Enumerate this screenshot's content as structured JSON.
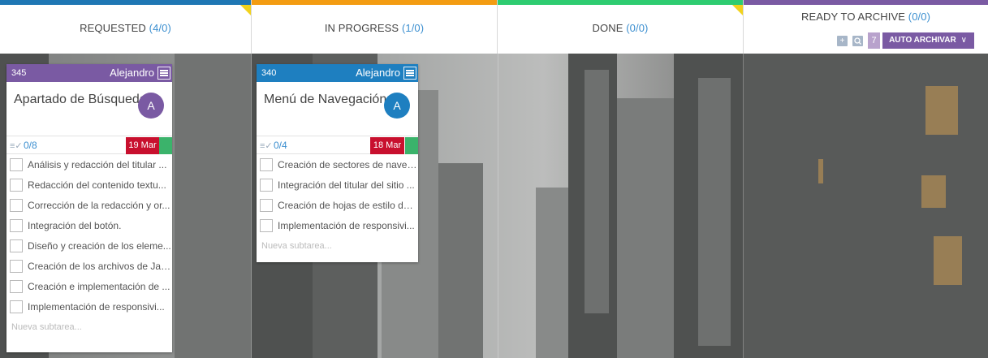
{
  "columns": [
    {
      "name": "REQUESTED",
      "count": "(4/0)",
      "color": "#1f77b4"
    },
    {
      "name": "IN PROGRESS",
      "count": "(1/0)",
      "color": "#f39c12"
    },
    {
      "name": "DONE",
      "count": "(0/0)",
      "color": "#2ecc71"
    },
    {
      "name": "READY TO ARCHIVE",
      "count": "(0/0)",
      "color": "#7a5aa3"
    }
  ],
  "archive_tools": {
    "add_icon": "plus-icon",
    "search_icon": "search-icon",
    "auto_count": "7",
    "auto_label": "AUTO ARCHIVAR",
    "chevron": "∨"
  },
  "cards": [
    {
      "id": "345",
      "owner": "Alejandro",
      "title": "Apartado de Búsqueda",
      "avatar": "A",
      "header_color": "#7a5aa3",
      "avatar_color": "#7a5aa3",
      "subtask_icon": "≡✓",
      "subtask_count": "0/8",
      "date": "19 Mar",
      "subtasks": [
        "Análisis y redacción del titular ...",
        "Redacción del contenido textu...",
        "Corrección de la redacción y or...",
        "Integración del botón.",
        "Diseño y creación de los eleme...",
        "Creación de los archivos de Jav...",
        "Creación e implementación de ...",
        "Implementación de responsivi..."
      ],
      "new_subtask_placeholder": "Nueva subtarea..."
    },
    {
      "id": "340",
      "owner": "Alejandro",
      "title": "Menú de Navegación",
      "avatar": "A",
      "header_color": "#1e7fc0",
      "avatar_color": "#1e7fc0",
      "subtask_icon": "≡✓",
      "subtask_count": "0/4",
      "date": "18 Mar",
      "subtasks": [
        "Creación de sectores de naveg...",
        "Integración del titular del sitio ...",
        "Creación de hojas de estilo del ...",
        "Implementación de responsivi..."
      ],
      "new_subtask_placeholder": "Nueva subtarea..."
    }
  ]
}
